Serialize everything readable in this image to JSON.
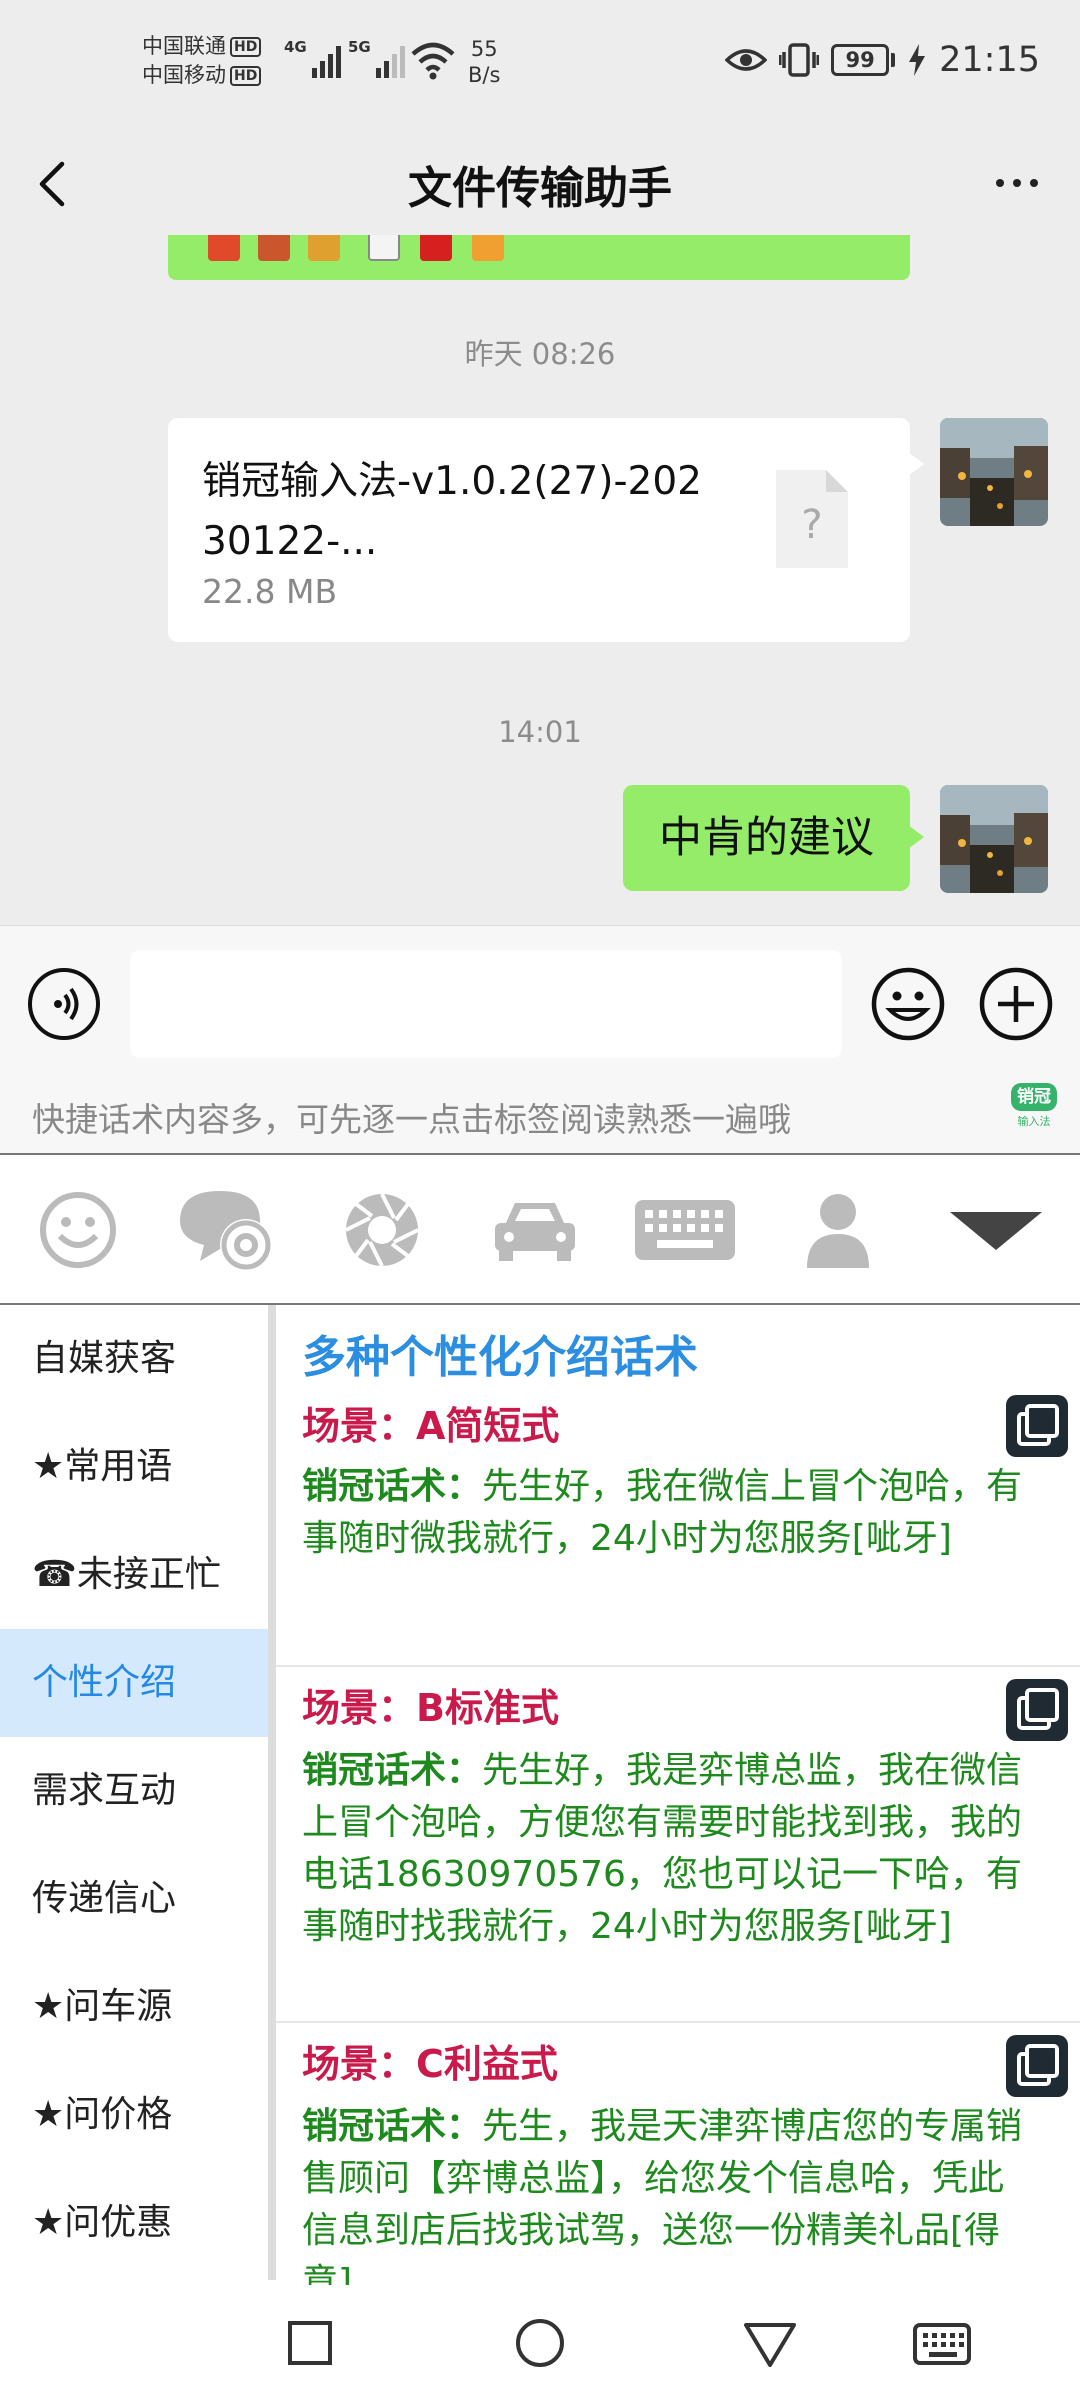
{
  "status": {
    "carrier1": "中国联通",
    "carrier2": "中国移动",
    "hd": "HD",
    "gen1": "4G",
    "gen2": "5G",
    "net_speed_value": "55",
    "net_speed_unit": "B/s",
    "battery": "99",
    "time": "21:15"
  },
  "header": {
    "title": "文件传输助手"
  },
  "chat": {
    "messages": [
      {
        "type": "time",
        "text": "昨天 08:26"
      },
      {
        "type": "file",
        "name": "销冠输入法-v1.0.2(27)-20230122-...",
        "size": "22.8 MB"
      },
      {
        "type": "time",
        "text": "14:01"
      },
      {
        "type": "text",
        "text": "中肯的建议"
      }
    ]
  },
  "input": {
    "placeholder": ""
  },
  "keyboard": {
    "hint": "快捷话术内容多，可先逐一点击标签阅读熟悉一遍哦",
    "logo": "销冠",
    "logo_sub": "输入法",
    "toolbar_icons": [
      "smiley-icon",
      "chat-settings-icon",
      "aperture-icon",
      "car-icon",
      "keyboard-icon",
      "person-icon",
      "collapse-icon"
    ],
    "categories": [
      "自媒获客",
      "★常用语",
      "☎未接正忙",
      "个性介绍",
      "需求互动",
      "传递信心",
      "★问车源",
      "★问价格",
      "★问优惠"
    ],
    "active_category": 3,
    "content_title": "多种个性化介绍话术",
    "entries": [
      {
        "scene": "场景：A简短式",
        "label": "销冠话术：",
        "text": "先生好，我在微信上冒个泡哈，有事随时微我就行，24小时为您服务[呲牙]"
      },
      {
        "scene": "场景：B标准式",
        "label": "销冠话术：",
        "text": "先生好，我是弈博总监，我在微信上冒个泡哈，方便您有需要时能找到我，我的电话18630970576，您也可以记一下哈，有事随时找我就行，24小时为您服务[呲牙]"
      },
      {
        "scene": "场景：C利益式",
        "label": "销冠话术：",
        "text": "先生，我是天津弈博店您的专属销售顾问【弈博总监】，给您发个信息哈，凭此信息到店后找我试驾，送您一份精美礼品[得意]"
      }
    ]
  },
  "colors": {
    "bubble_green": "#95ec69",
    "active_blue": "#2588e4",
    "scene_red": "#c91a4b",
    "script_green": "#1e8a1e"
  }
}
